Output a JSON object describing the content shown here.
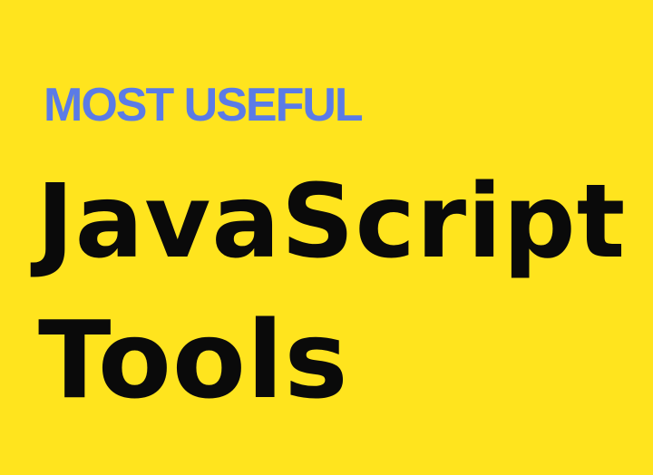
{
  "graphic": {
    "kicker": "MOST USEFUL",
    "title_line1": "JavaScript",
    "title_line2": "Tools"
  },
  "colors": {
    "background": "#ffe41e",
    "kicker": "#5b7be6",
    "title": "#0a0a0a"
  }
}
